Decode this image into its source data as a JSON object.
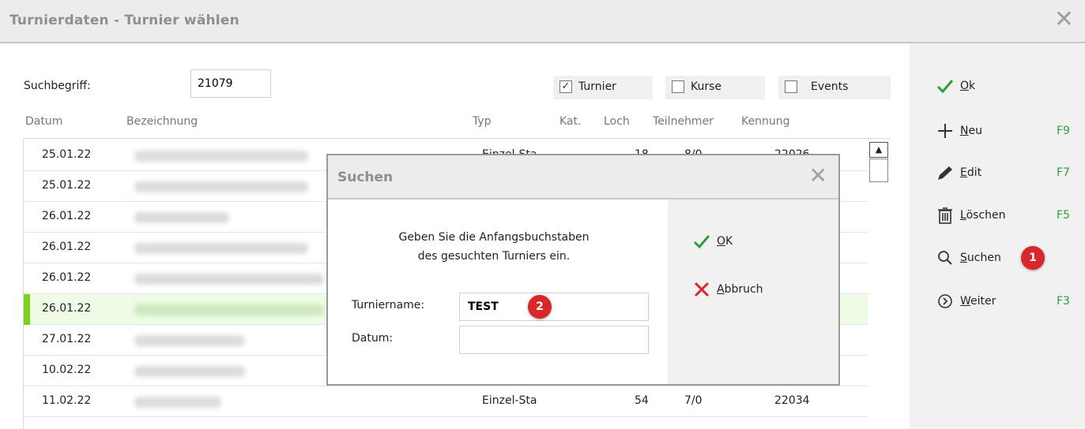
{
  "window": {
    "title": "Turnierdaten - Turnier wählen",
    "close_glyph": "✕"
  },
  "search": {
    "label": "Suchbegriff:",
    "value": "21079"
  },
  "filters": [
    {
      "label": "Turnier",
      "checked": true,
      "mark": "✓"
    },
    {
      "label": "Kurse",
      "checked": false,
      "mark": ""
    },
    {
      "label": "Events",
      "checked": false,
      "mark": ""
    }
  ],
  "columns": {
    "datum": "Datum",
    "bezeichnung": "Bezeichnung",
    "typ": "Typ",
    "kat": "Kat.",
    "loch": "Loch",
    "teilnehmer": "Teilnehmer",
    "kennung": "Kennung"
  },
  "rows": [
    {
      "datum": "25.01.22",
      "typ": "Einzel-Sta",
      "loch": "18",
      "teilnehmer": "8/0",
      "kennung": "22026"
    },
    {
      "datum": "25.01.22"
    },
    {
      "datum": "26.01.22"
    },
    {
      "datum": "26.01.22"
    },
    {
      "datum": "26.01.22"
    },
    {
      "datum": "26.01.22",
      "selected": true
    },
    {
      "datum": "27.01.22"
    },
    {
      "datum": "10.02.22"
    },
    {
      "datum": "11.02.22",
      "typ": "Einzel-Sta",
      "loch": "54",
      "teilnehmer": "7/0",
      "kennung": "22034"
    }
  ],
  "sidebar": {
    "ok": {
      "label": "Ok",
      "icon": "check-icon"
    },
    "new": {
      "label": "Neu",
      "key": "F9",
      "icon": "plus-icon"
    },
    "edit": {
      "label": "Edit",
      "key": "F7",
      "icon": "pencil-icon"
    },
    "delete": {
      "label": "Löschen",
      "key": "F5",
      "icon": "trash-icon"
    },
    "search": {
      "label": "Suchen",
      "icon": "magnifier-icon"
    },
    "next": {
      "label": "Weiter",
      "key": "F3",
      "icon": "chevron-circle-icon"
    }
  },
  "annotations": {
    "badge1": "1",
    "badge2": "2"
  },
  "dialog": {
    "title": "Suchen",
    "close_glyph": "✕",
    "instruction_line1": "Geben Sie die Anfangsbuchstaben",
    "instruction_line2": "des gesuchten Turniers ein.",
    "turniername_label": "Turniername:",
    "turniername_value": "TEST",
    "datum_label": "Datum:",
    "datum_value": "",
    "ok_label": "OK",
    "cancel_label": "Abbruch"
  },
  "colors": {
    "accent_green": "#2f9d3a",
    "selected_bar": "#7ed321",
    "badge_red": "#d9262a",
    "cancel_red": "#d9262a"
  }
}
